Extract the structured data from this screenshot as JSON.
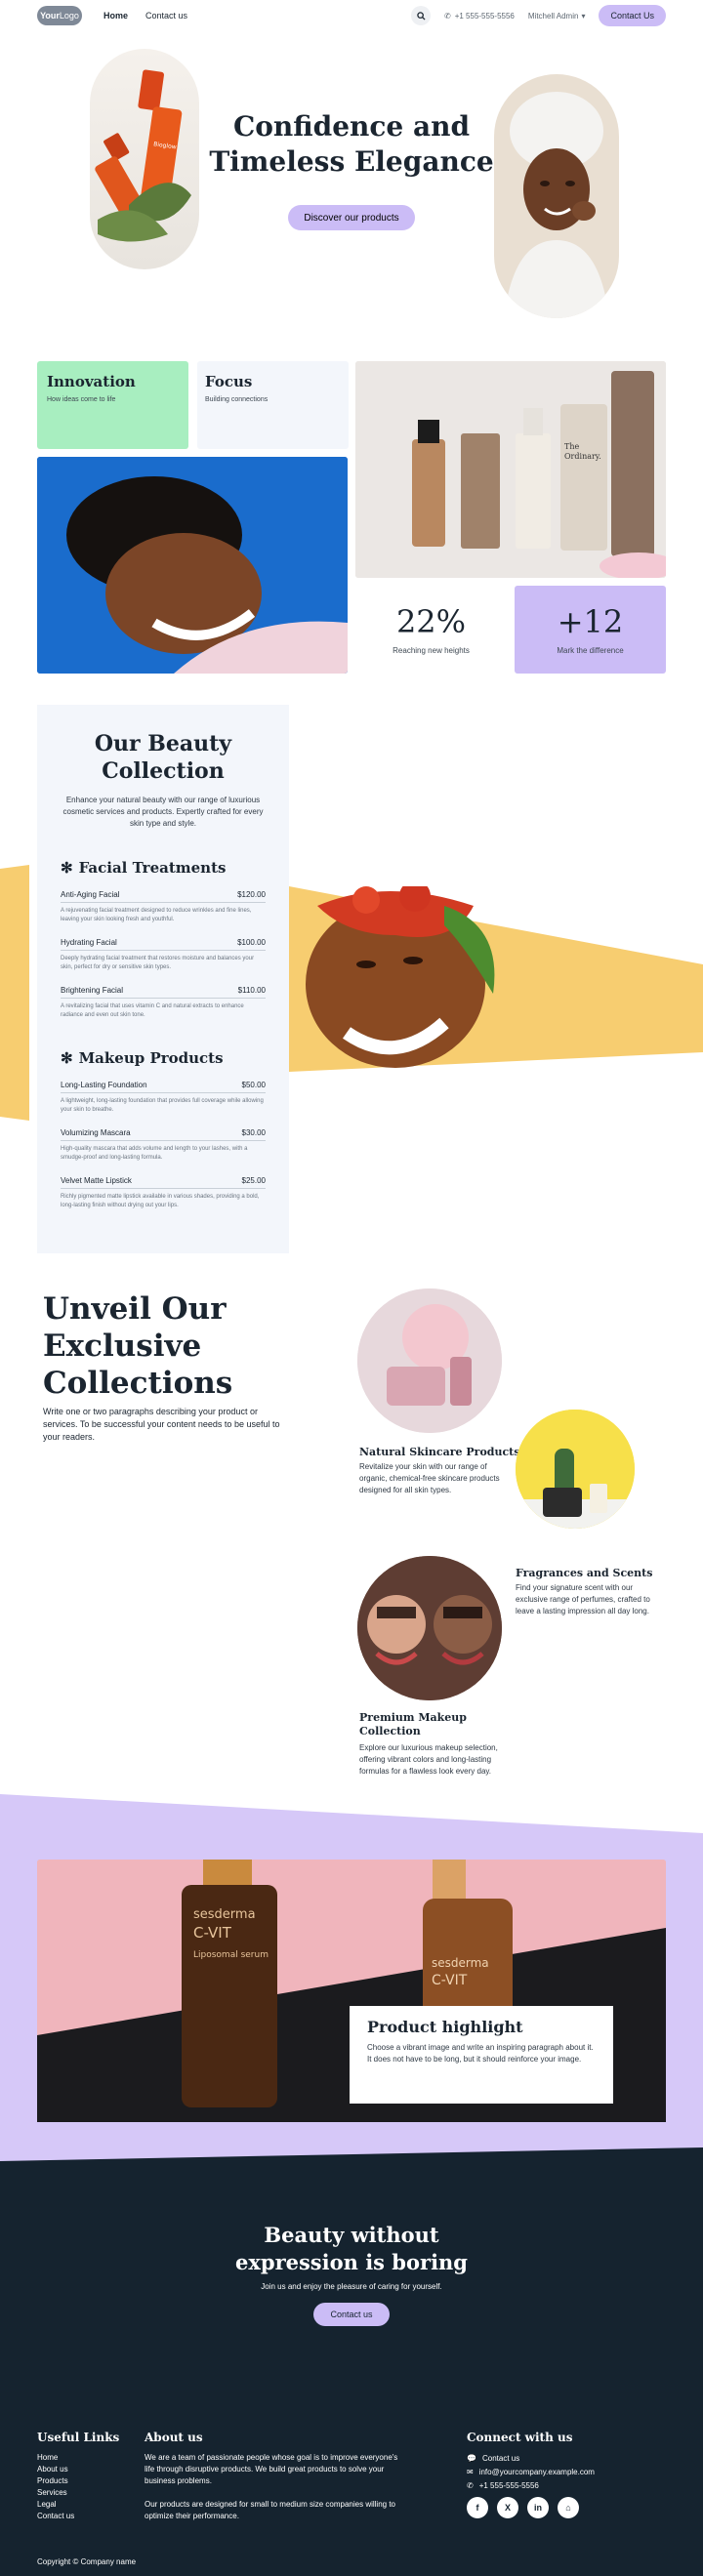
{
  "header": {
    "logo": {
      "bold": "Your",
      "rest": "Logo"
    },
    "nav": [
      "Home",
      "Contact us"
    ],
    "phone": "+1 555-555-5556",
    "user": "Mitchell Admin",
    "cta": "Contact Us",
    "icons": {
      "search": "search-icon",
      "phone": "phone-icon",
      "caret": "caret-down-icon"
    }
  },
  "hero": {
    "title": "Confidence and Timeless Elegance",
    "button": "Discover our products"
  },
  "features": {
    "tiles": [
      {
        "title": "Innovation",
        "subtitle": "How ideas come to life",
        "color": "#a8eec0"
      },
      {
        "title": "Focus",
        "subtitle": "Building connections",
        "color": "#f3f6fb"
      }
    ],
    "stats": [
      {
        "value": "22%",
        "label": "Reaching new heights"
      },
      {
        "value": "+12",
        "label": "Mark the difference"
      }
    ]
  },
  "collection": {
    "title": "Our Beauty Collection",
    "lead": "Enhance your natural beauty with our range of luxurious cosmetic services and products. Expertly crafted for every skin type and style.",
    "sections": [
      {
        "title": "Facial Treatments",
        "items": [
          {
            "name": "Anti-Aging Facial",
            "price": "$120.00",
            "desc": "A rejuvenating facial treatment designed to reduce wrinkles and fine lines, leaving your skin looking fresh and youthful."
          },
          {
            "name": "Hydrating Facial",
            "price": "$100.00",
            "desc": "Deeply hydrating facial treatment that restores moisture and balances your skin, perfect for dry or sensitive skin types."
          },
          {
            "name": "Brightening Facial",
            "price": "$110.00",
            "desc": "A revitalizing facial that uses vitamin C and natural extracts to enhance radiance and even out skin tone."
          }
        ]
      },
      {
        "title": "Makeup Products",
        "items": [
          {
            "name": "Long-Lasting Foundation",
            "price": "$50.00",
            "desc": "A lightweight, long-lasting foundation that provides full coverage while allowing your skin to breathe."
          },
          {
            "name": "Volumizing Mascara",
            "price": "$30.00",
            "desc": "High-quality mascara that adds volume and length to your lashes, with a smudge-proof and long-lasting formula."
          },
          {
            "name": "Velvet Matte Lipstick",
            "price": "$25.00",
            "desc": "Richly pigmented matte lipstick available in various shades, providing a bold, long-lasting finish without drying out your lips."
          }
        ]
      }
    ]
  },
  "unveil": {
    "title": "Unveil Our Exclusive Collections",
    "text": "Write one or two paragraphs describing your product or services. To be successful your content needs to be useful to your readers.",
    "products": [
      {
        "title": "Natural Skincare Products",
        "desc": "Revitalize your skin with our range of organic, chemical-free skincare products designed for all skin types."
      },
      {
        "title": "Fragrances and Scents",
        "desc": "Find your signature scent with our exclusive range of perfumes, crafted to leave a lasting impression all day long."
      },
      {
        "title": "Premium Makeup Collection",
        "desc": "Explore our luxurious makeup selection, offering vibrant colors and long-lasting formulas for a flawless look every day."
      }
    ]
  },
  "highlight": {
    "title": "Product highlight",
    "text": "Choose a vibrant image and write an inspiring paragraph about it. It does not have to be long, but it should reinforce your image.",
    "bottle_brand": "sesderma",
    "bottle_name": "C-VIT",
    "bottle_sub": "Liposomal serum"
  },
  "cta": {
    "title": "Beauty without expression is boring",
    "subtitle": "Join us and enjoy the pleasure of caring for yourself.",
    "button": "Contact us"
  },
  "footer": {
    "links_title": "Useful Links",
    "links": [
      "Home",
      "About us",
      "Products",
      "Services",
      "Legal",
      "Contact us"
    ],
    "about_title": "About us",
    "about_p1": "We are a team of passionate people whose goal is to improve everyone's life through disruptive products. We build great products to solve your business problems.",
    "about_p2": "Our products are designed for small to medium size companies willing to optimize their performance.",
    "contact_title": "Connect with us",
    "contact": [
      "Contact us",
      "info@yourcompany.example.com",
      "+1 555-555-5556"
    ],
    "socials": [
      "f",
      "X",
      "in",
      "⌂"
    ],
    "copyright": "Copyright © Company name"
  },
  "colors": {
    "accent": "#cbbcf6",
    "mint": "#a8eec0",
    "dark": "#15232f",
    "sun": "#f7cd70",
    "lavender_bg": "#d6c8f8"
  }
}
